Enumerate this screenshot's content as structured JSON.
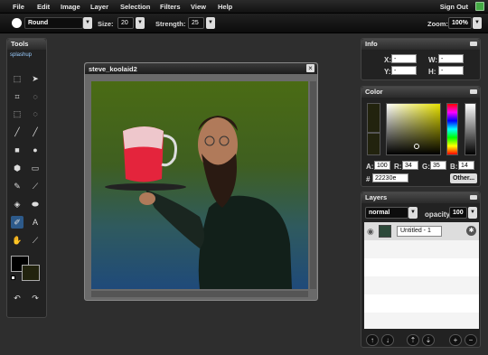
{
  "menubar": {
    "items": [
      "File",
      "Edit",
      "Image",
      "Layer",
      "Selection",
      "Filters",
      "View",
      "Help"
    ],
    "signout": "Sign Out"
  },
  "options": {
    "brush_shape": "Round",
    "size_label": "Size:",
    "size_value": "20",
    "strength_label": "Strength:",
    "strength_value": "25",
    "zoom_label": "Zoom:",
    "zoom_value": "100%"
  },
  "tools": {
    "title": "Tools",
    "logo": "splashup"
  },
  "canvas": {
    "title": "steve_koolaid2",
    "close": "×"
  },
  "info": {
    "title": "Info",
    "x_label": "X:",
    "x_value": "-",
    "y_label": "Y:",
    "y_value": "-",
    "w_label": "W:",
    "w_value": "-",
    "h_label": "H:",
    "h_value": "-"
  },
  "color": {
    "title": "Color",
    "a_label": "A:",
    "a_value": "100",
    "r_label": "R:",
    "r_value": "34",
    "g_label": "G:",
    "g_value": "35",
    "b_label": "B:",
    "b_value": "14",
    "hash": "#",
    "hex_value": "22230e",
    "other_button": "Other...",
    "fg_color": "#22230e"
  },
  "layers": {
    "title": "Layers",
    "blend_mode": "normal",
    "opacity_label": "opacity:",
    "opacity_value": "100",
    "items": [
      {
        "name": "Untitled - 1"
      }
    ]
  }
}
